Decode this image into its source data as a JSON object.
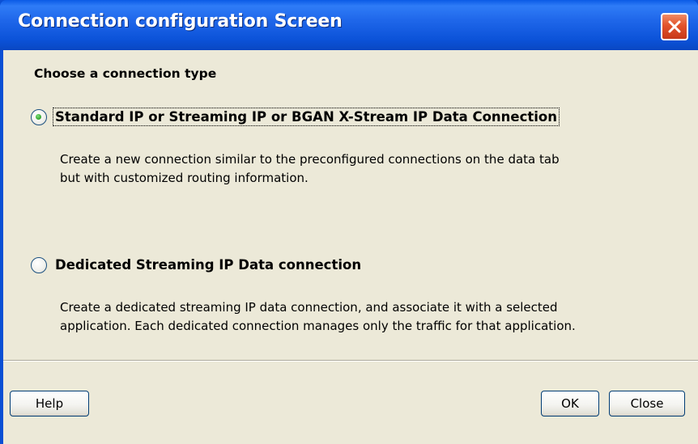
{
  "window": {
    "title": "Connection configuration Screen"
  },
  "heading": "Choose a connection type",
  "options": [
    {
      "label": "Standard IP or Streaming IP or BGAN X-Stream IP Data Connection",
      "selected": true,
      "description": [
        "Create a new connection similar to the preconfigured connections on the data tab",
        "but with customized routing information."
      ]
    },
    {
      "label": "Dedicated Streaming IP Data connection",
      "selected": false,
      "description": [
        "Create a dedicated streaming IP data connection, and associate it with a selected",
        "application. Each dedicated connection manages only the traffic for that application."
      ]
    }
  ],
  "buttons": {
    "help": "Help",
    "ok": "OK",
    "close": "Close"
  },
  "colors": {
    "titlebar": "#0a4fd4",
    "client_bg": "#ece9d8",
    "close_button": "#e2532b",
    "radio_selected": "#2fa12c"
  }
}
